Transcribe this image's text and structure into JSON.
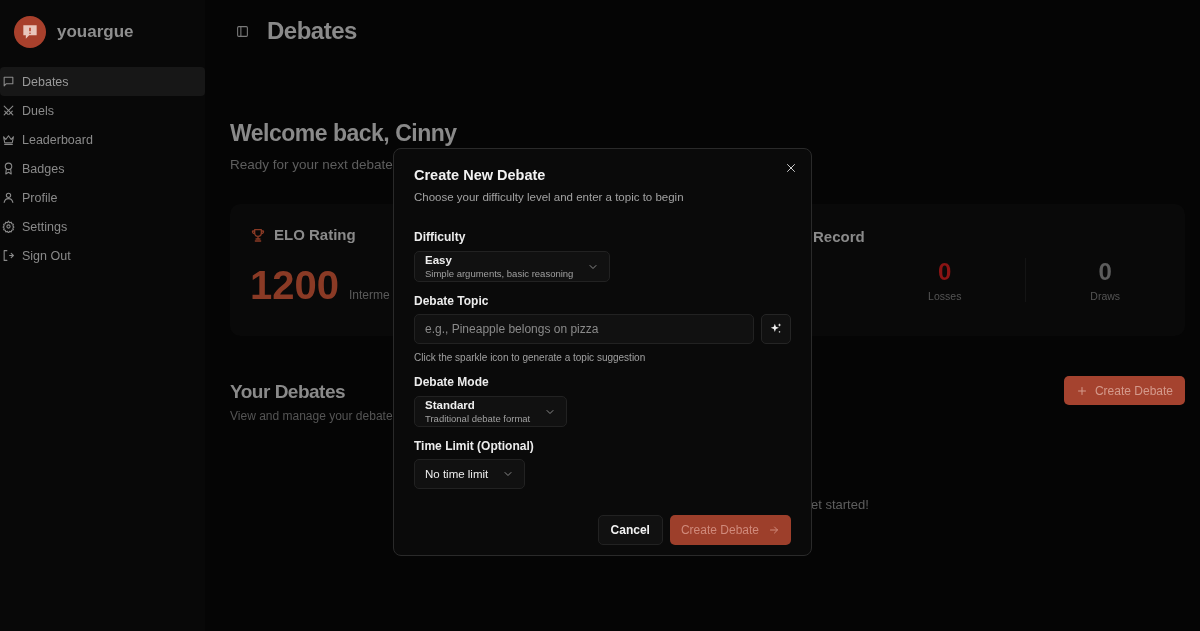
{
  "brand": {
    "name": "youargue"
  },
  "sidebar": {
    "items": [
      {
        "label": "Debates",
        "selected": true
      },
      {
        "label": "Duels",
        "selected": false
      },
      {
        "label": "Leaderboard",
        "selected": false
      },
      {
        "label": "Badges",
        "selected": false
      },
      {
        "label": "Profile",
        "selected": false
      },
      {
        "label": "Settings",
        "selected": false
      },
      {
        "label": "Sign Out",
        "selected": false
      }
    ]
  },
  "header": {
    "title": "Debates"
  },
  "welcome": {
    "title": "Welcome back, Cinny",
    "subtitle": "Ready for your next debate"
  },
  "elo_card": {
    "title": "ELO Rating",
    "value": "1200",
    "tier": "Interme"
  },
  "record_card": {
    "title": "Record",
    "stats": [
      {
        "value": "0",
        "label": "Losses",
        "color": "#8a1414"
      },
      {
        "value": "0",
        "label": "Draws",
        "color": "#5c5c5c"
      }
    ]
  },
  "debates_section": {
    "title": "Your Debates",
    "subtitle": "View and manage your debate",
    "create_button": "Create Debate",
    "empty_text": "et started!"
  },
  "modal": {
    "title": "Create New Debate",
    "description": "Choose your difficulty level and enter a topic to begin",
    "fields": [
      {
        "kind": "select",
        "label": "Difficulty",
        "value": "Easy",
        "detail": "Simple arguments, basic reasoning"
      },
      {
        "kind": "text",
        "label": "Debate Topic",
        "placeholder": "e.g., Pineapple belongs on pizza",
        "hint": "Click the sparkle icon to generate a topic suggestion"
      },
      {
        "kind": "select",
        "label": "Debate Mode",
        "value": "Standard",
        "detail": "Traditional debate format"
      },
      {
        "kind": "select",
        "label": "Time Limit (Optional)",
        "value": "No time limit"
      }
    ],
    "buttons": [
      {
        "kind": "secondary",
        "label": "Cancel"
      },
      {
        "kind": "primary",
        "label": "Create Debate"
      }
    ]
  }
}
